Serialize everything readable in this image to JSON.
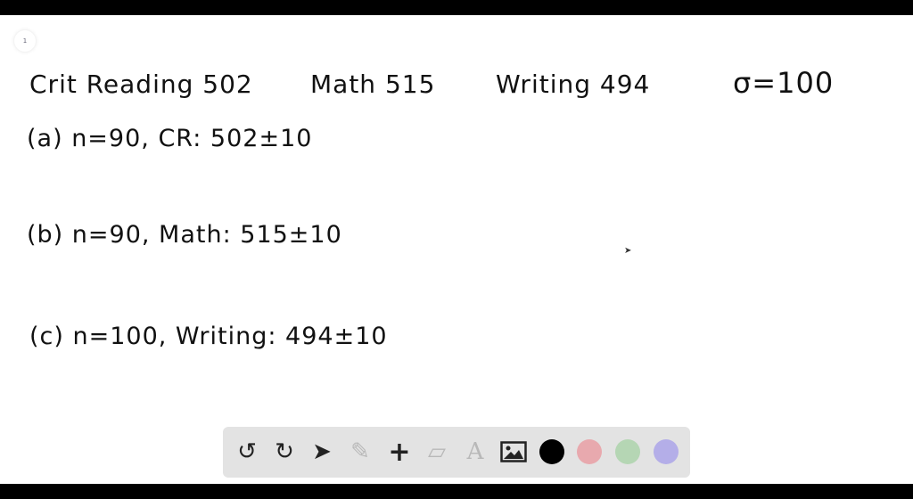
{
  "page_indicator": "1",
  "header_line": {
    "crit_reading": "Crit Reading 502",
    "math": "Math 515",
    "writing": "Writing 494",
    "sigma": "σ=100"
  },
  "parts": [
    {
      "text": "(a) n=90, CR: 502±10"
    },
    {
      "text": "(b) n=90, Math: 515±10"
    },
    {
      "text": "(c) n=100, Writing: 494±10"
    }
  ],
  "toolbar": {
    "tools": [
      "undo-icon",
      "redo-icon",
      "pointer-icon",
      "pencil-icon",
      "plus-icon",
      "eraser-icon",
      "text-icon",
      "image-icon"
    ],
    "colors": [
      "#000000",
      "#e8a9ae",
      "#b5d6b4",
      "#b4aee8"
    ]
  }
}
